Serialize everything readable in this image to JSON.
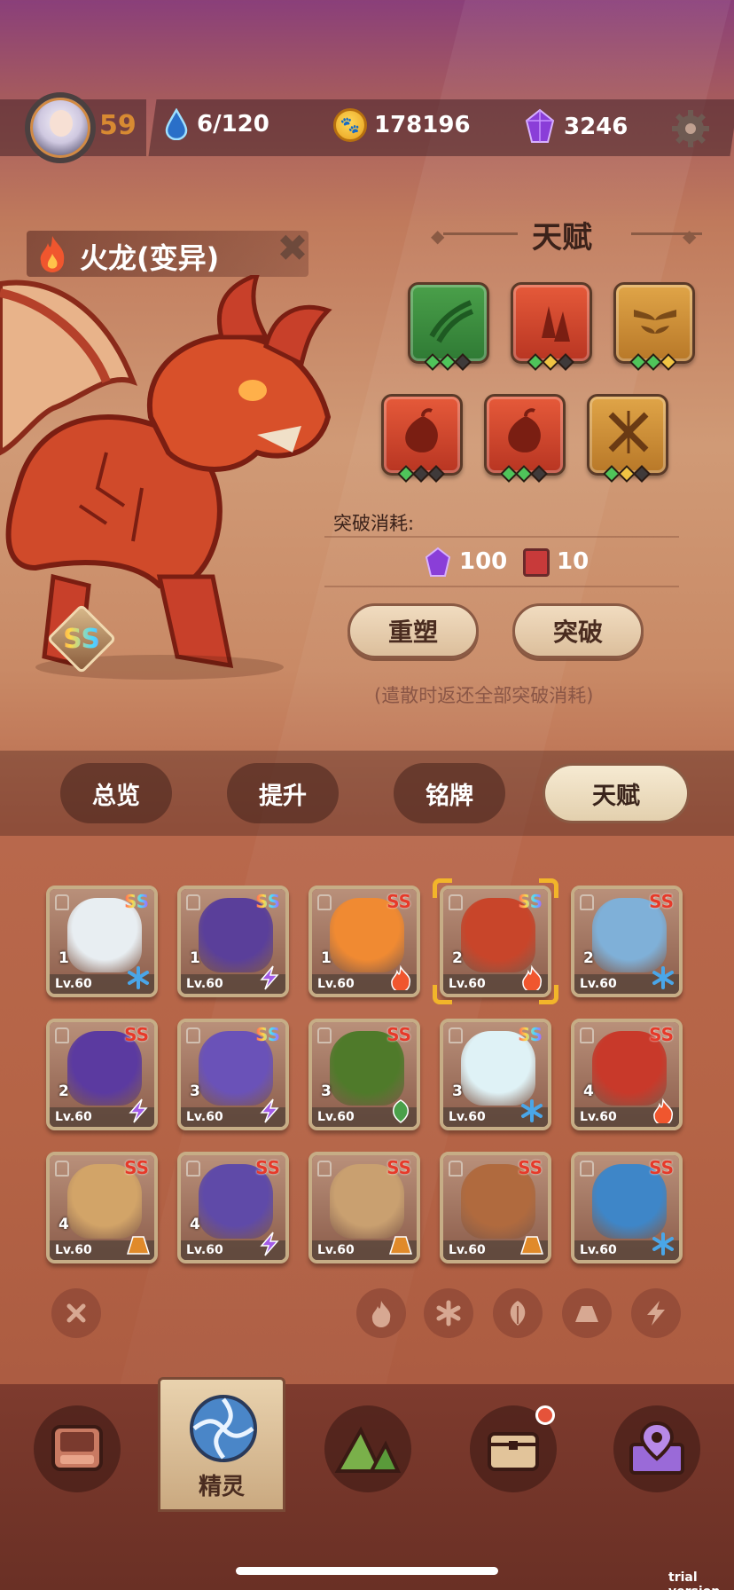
{
  "header": {
    "player_level": "59",
    "stamina": "6/120",
    "coins": "178196",
    "gems": "3246"
  },
  "pet": {
    "name": "火龙(变异)",
    "rarity": "SS"
  },
  "talent": {
    "title": "天赋",
    "slots": [
      {
        "icon": "claw-icon",
        "color": "green",
        "pips": [
          "g",
          "g",
          "d"
        ]
      },
      {
        "icon": "flame-shards-icon",
        "color": "red",
        "pips": [
          "g",
          "y",
          "d"
        ]
      },
      {
        "icon": "wings-emblem-icon",
        "color": "gold",
        "pips": [
          "g",
          "g",
          "y"
        ]
      },
      {
        "icon": "fire-seed-icon",
        "color": "red",
        "pips": [
          "g",
          "d",
          "d"
        ]
      },
      {
        "icon": "fire-seed-icon",
        "color": "red",
        "pips": [
          "g",
          "g",
          "d"
        ]
      },
      {
        "icon": "cross-slash-icon",
        "color": "gold",
        "pips": [
          "g",
          "y",
          "d"
        ]
      }
    ],
    "cost_label": "突破消耗:",
    "cost_gem": "100",
    "cost_book": "10",
    "reset_label": "重塑",
    "break_label": "突破",
    "note": "(遣散时返还全部突破消耗)"
  },
  "tabs": [
    "总览",
    "提升",
    "铭牌",
    "天赋"
  ],
  "active_tab": "天赋",
  "pets": [
    {
      "rank": "1",
      "level": "Lv.60",
      "rarity": "SS",
      "rainbow": true,
      "element": "ice",
      "color": "#e8eef2"
    },
    {
      "rank": "1",
      "level": "Lv.60",
      "rarity": "SS",
      "rainbow": true,
      "element": "thunder",
      "color": "#5a3f9a"
    },
    {
      "rank": "1",
      "level": "Lv.60",
      "rarity": "SS",
      "rainbow": false,
      "element": "fire",
      "color": "#f08a32"
    },
    {
      "rank": "2",
      "level": "Lv.60",
      "rarity": "SS",
      "rainbow": true,
      "element": "fire",
      "color": "#c8452a",
      "selected": true
    },
    {
      "rank": "2",
      "level": "Lv.60",
      "rarity": "SS",
      "rainbow": false,
      "element": "ice",
      "color": "#7fb0d8"
    },
    {
      "rank": "2",
      "level": "Lv.60",
      "rarity": "SS",
      "rainbow": false,
      "element": "thunder",
      "color": "#5b3aa0"
    },
    {
      "rank": "3",
      "level": "Lv.60",
      "rarity": "SS",
      "rainbow": true,
      "element": "thunder",
      "color": "#6a52b8"
    },
    {
      "rank": "3",
      "level": "Lv.60",
      "rarity": "SS",
      "rainbow": false,
      "element": "grass",
      "color": "#4f7a2a"
    },
    {
      "rank": "3",
      "level": "Lv.60",
      "rarity": "SS",
      "rainbow": true,
      "element": "ice",
      "color": "#dff2f6"
    },
    {
      "rank": "4",
      "level": "Lv.60",
      "rarity": "SS",
      "rainbow": false,
      "element": "fire",
      "color": "#c8392a"
    },
    {
      "rank": "4",
      "level": "Lv.60",
      "rarity": "SS",
      "rainbow": false,
      "element": "earth",
      "color": "#d2a468"
    },
    {
      "rank": "4",
      "level": "Lv.60",
      "rarity": "SS",
      "rainbow": false,
      "element": "thunder",
      "color": "#5f4aa8"
    },
    {
      "rank": "",
      "level": "Lv.60",
      "rarity": "SS",
      "rainbow": false,
      "element": "earth",
      "color": "#c9a070"
    },
    {
      "rank": "",
      "level": "Lv.60",
      "rarity": "SS",
      "rainbow": false,
      "element": "earth",
      "color": "#b06a3e"
    },
    {
      "rank": "",
      "level": "Lv.60",
      "rarity": "SS",
      "rainbow": false,
      "element": "ice",
      "color": "#3e86c8"
    }
  ],
  "filters": [
    "clear-filter-icon",
    "fire-icon",
    "ice-icon",
    "grass-icon",
    "earth-icon",
    "thunder-icon"
  ],
  "nav": {
    "active_label": "精灵"
  },
  "colors": {
    "fire": "#f0562e",
    "ice": "#4aa6e8",
    "thunder": "#a35ce8",
    "grass": "#4aa04a",
    "earth": "#e08a2a",
    "ss_red": "#e63a2a"
  },
  "watermark": "trial version"
}
